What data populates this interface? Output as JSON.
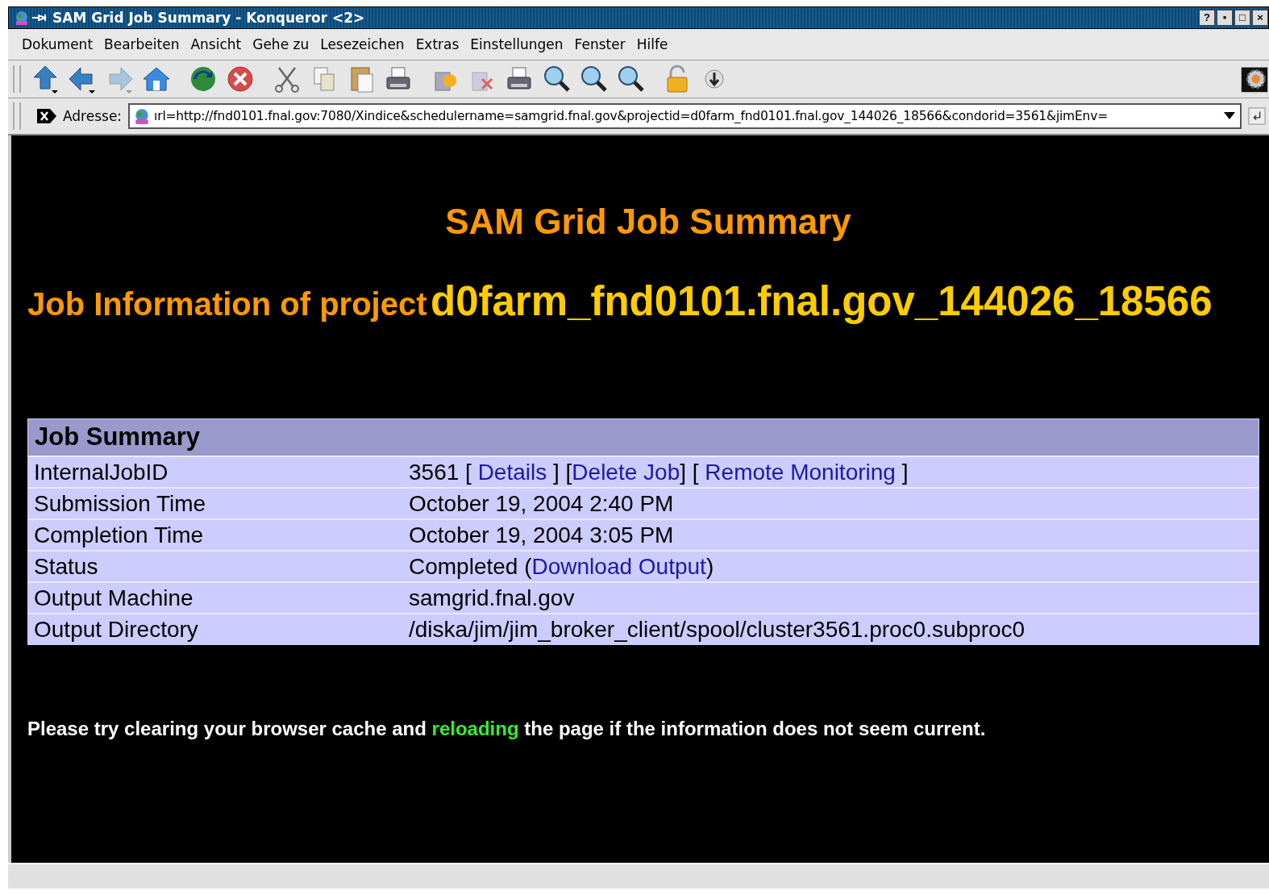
{
  "window": {
    "title": "SAM Grid Job Summary - Konqueror <2>",
    "buttons": [
      "?",
      "▪",
      "□",
      "×"
    ]
  },
  "menu": [
    "Dokument",
    "Bearbeiten",
    "Ansicht",
    "Gehe zu",
    "Lesezeichen",
    "Extras",
    "Einstellungen",
    "Fenster",
    "Hilfe"
  ],
  "address": {
    "label": "Adresse:",
    "value": "ırl=http://fnd0101.fnal.gov:7080/Xindice&schedulername=samgrid.fnal.gov&projectid=d0farm_fnd0101.fnal.gov_144026_18566&condorid=3561&jimEnv="
  },
  "page": {
    "title": "SAM Grid Job Summary",
    "subtitle": "Job Information of project",
    "project": "d0farm_fnd0101.fnal.gov_144026_18566",
    "table": {
      "heading": "Job Summary",
      "rows": [
        {
          "label": "InternalJobID",
          "value": [
            {
              "kind": "text",
              "text": "3561 [ "
            },
            {
              "kind": "link",
              "text": "Details"
            },
            {
              "kind": "text",
              "text": " ] ["
            },
            {
              "kind": "link",
              "text": "Delete Job"
            },
            {
              "kind": "text",
              "text": "] [ "
            },
            {
              "kind": "link",
              "text": "Remote Monitoring"
            },
            {
              "kind": "text",
              "text": " ]"
            }
          ]
        },
        {
          "label": "Submission Time",
          "value": [
            {
              "kind": "text",
              "text": "October 19, 2004 2:40 PM"
            }
          ]
        },
        {
          "label": "Completion Time",
          "value": [
            {
              "kind": "text",
              "text": "October 19, 2004 3:05 PM"
            }
          ]
        },
        {
          "label": "Status",
          "value": [
            {
              "kind": "text",
              "text": "Completed ("
            },
            {
              "kind": "link",
              "text": "Download Output"
            },
            {
              "kind": "text",
              "text": ")"
            }
          ]
        },
        {
          "label": "Output Machine",
          "value": [
            {
              "kind": "text",
              "text": "samgrid.fnal.gov"
            }
          ]
        },
        {
          "label": "Output Directory",
          "value": [
            {
              "kind": "text",
              "text": "/diska/jim/jim_broker_client/spool/cluster3561.proc0.subproc0"
            }
          ]
        }
      ]
    },
    "note": [
      {
        "kind": "text",
        "text": "Please try clearing your browser cache and "
      },
      {
        "kind": "link",
        "text": "reloading"
      },
      {
        "kind": "text",
        "text": " the page if the information does not seem current."
      }
    ]
  }
}
